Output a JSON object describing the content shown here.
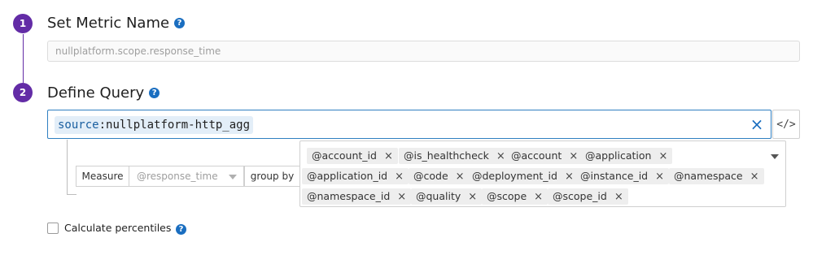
{
  "step1": {
    "number": "1",
    "title": "Set Metric Name",
    "metric_placeholder": "nullplatform.scope.response_time"
  },
  "step2": {
    "number": "2",
    "title": "Define Query",
    "query": {
      "key": "source",
      "separator": ":",
      "value": "nullplatform-http_agg"
    },
    "measure_label": "Measure",
    "measure_placeholder": "@response_time",
    "group_by_label": "group by",
    "group_by_tags": [
      "@account_id",
      "@is_healthcheck",
      "@account",
      "@application",
      "@application_id",
      "@code",
      "@deployment_id",
      "@instance_id",
      "@namespace",
      "@namespace_id",
      "@quality",
      "@scope",
      "@scope_id"
    ]
  },
  "percentiles_label": "Calculate percentiles",
  "icons": {
    "help": "?",
    "clear": "×",
    "code": "</>",
    "tag_remove": "×"
  },
  "colors": {
    "step_badge": "#632ca6",
    "help_icon": "#1a6ec0",
    "query_border": "#2f7fc1",
    "query_pill_bg": "#e3eef8"
  }
}
